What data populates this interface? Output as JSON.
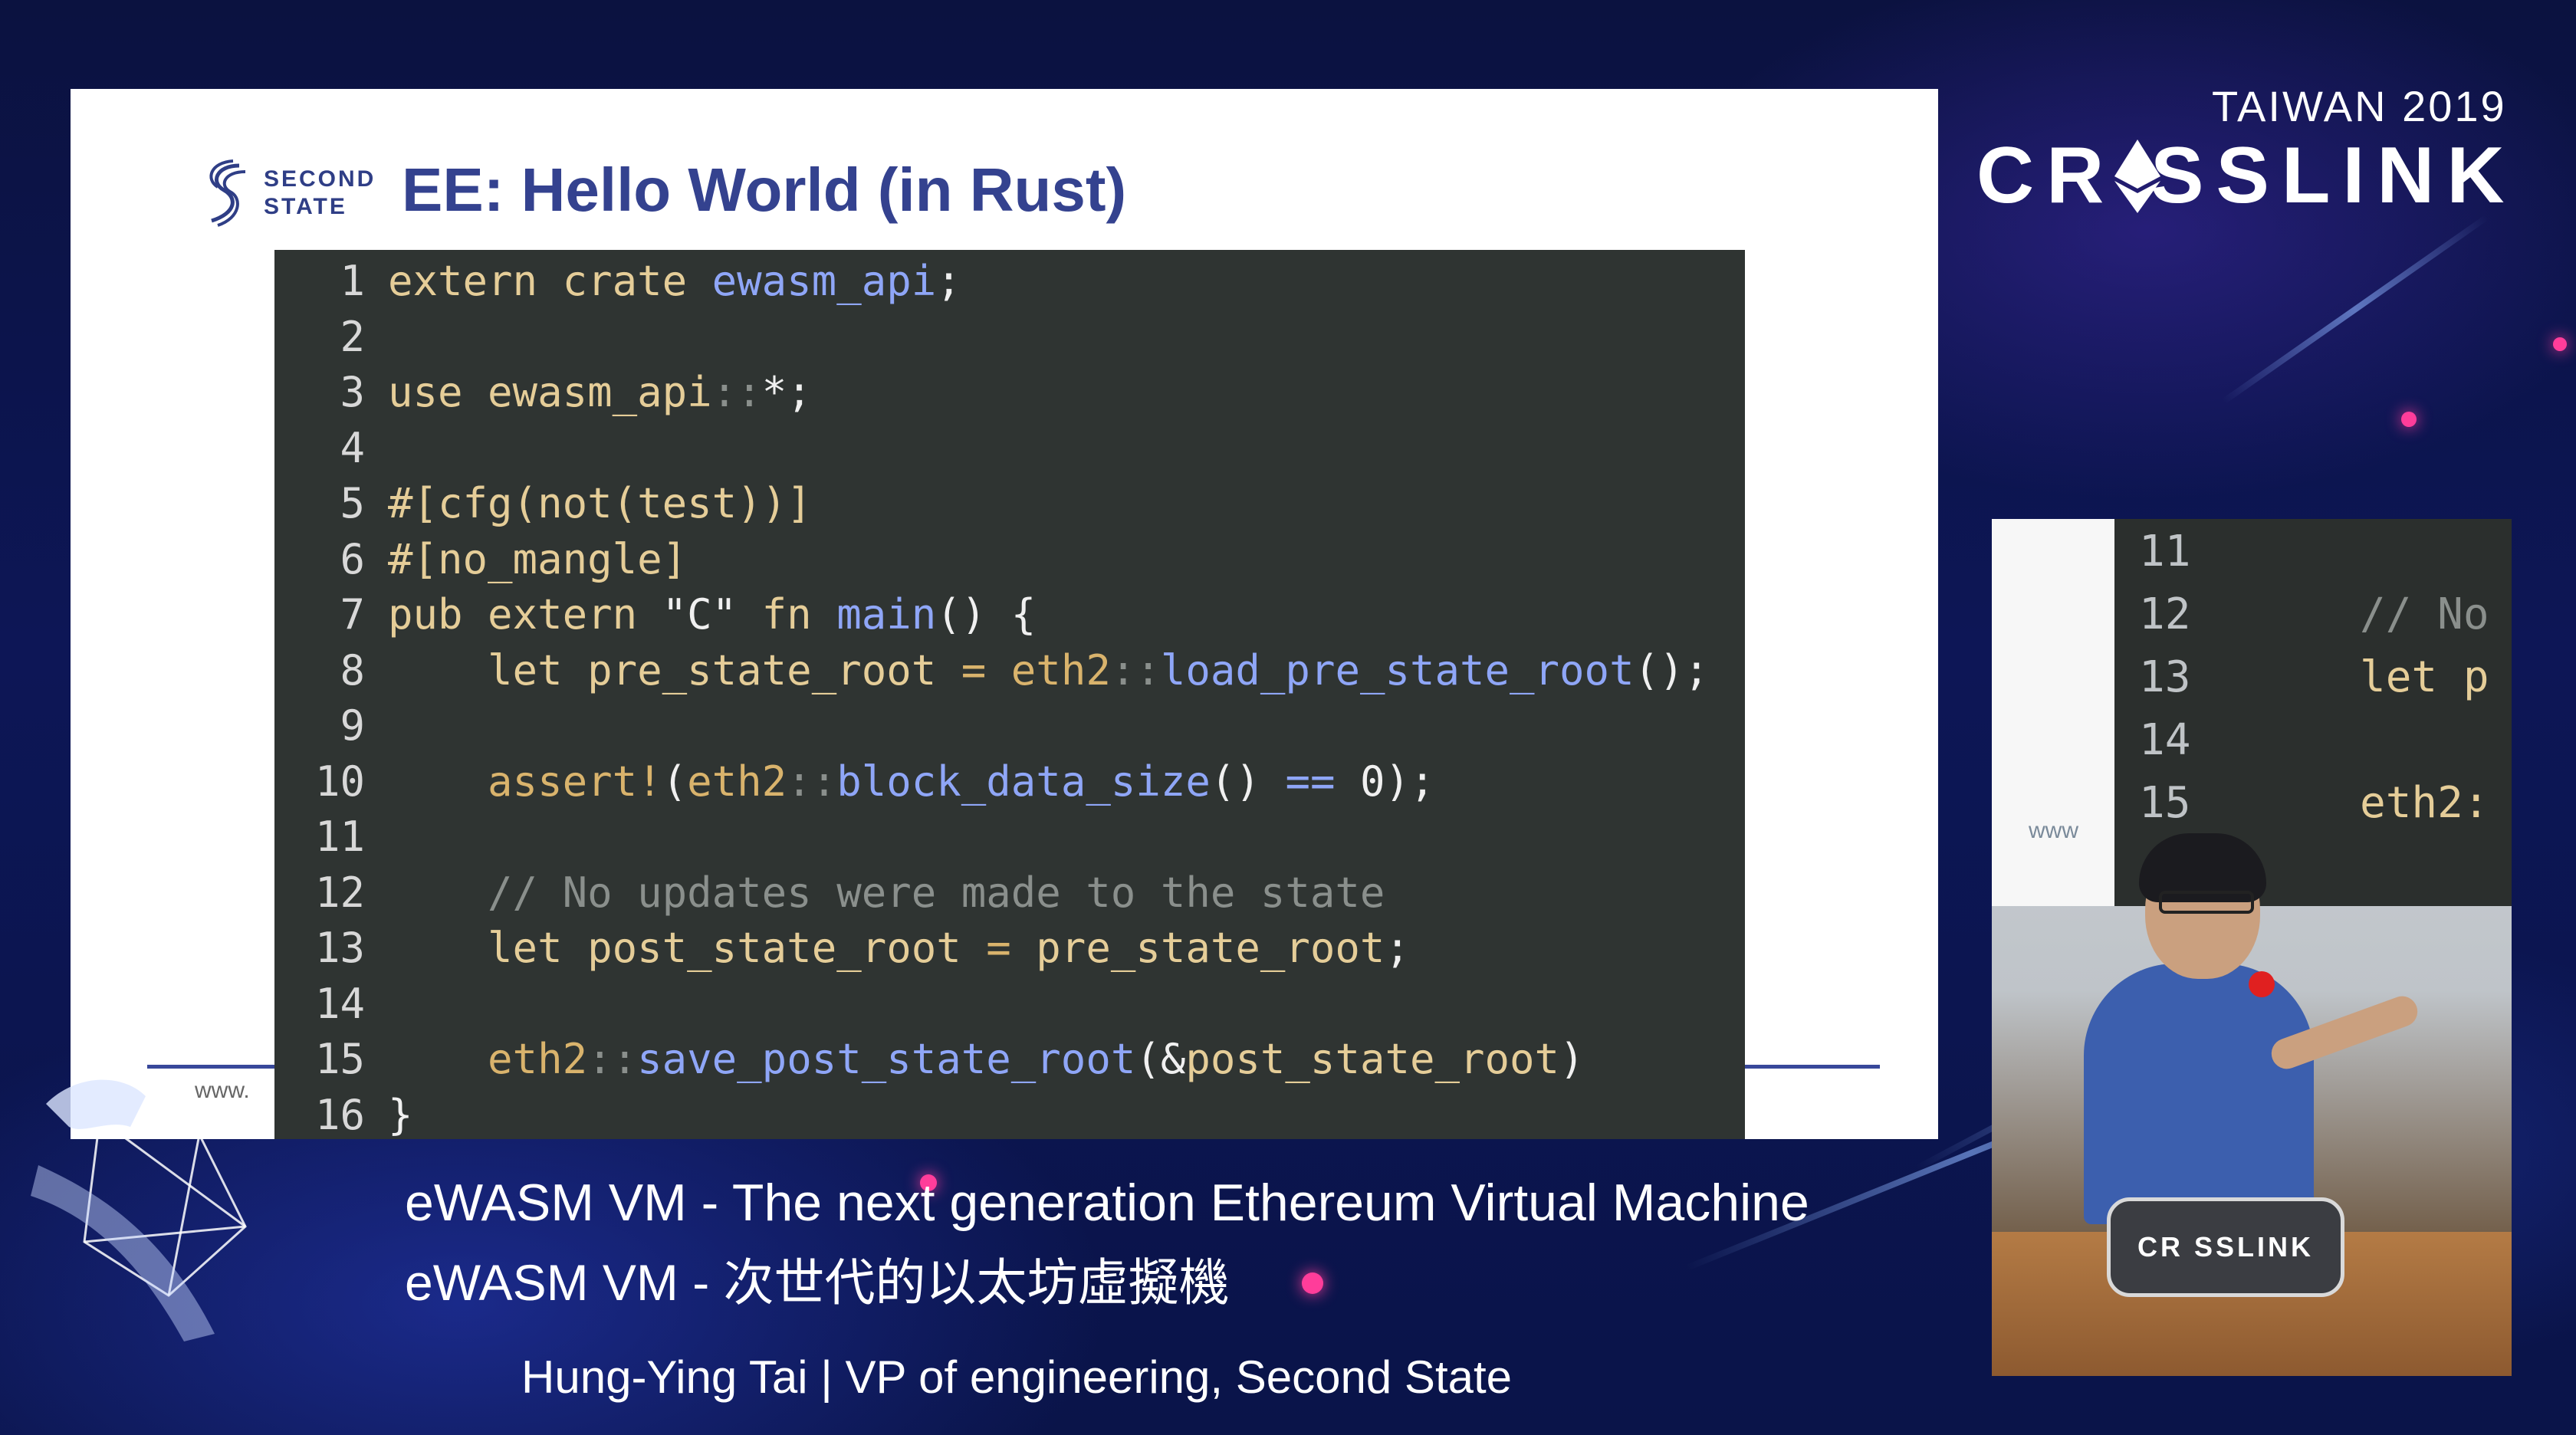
{
  "slide": {
    "logo_text_line1": "SECOND",
    "logo_text_line2": "STATE",
    "title": "EE: Hello World (in Rust)",
    "footer_url": "www."
  },
  "code": {
    "lines": [
      {
        "n": "1",
        "tokens": [
          [
            "k",
            "extern crate "
          ],
          [
            "f",
            "ewasm_api"
          ],
          [
            "p",
            ";"
          ]
        ]
      },
      {
        "n": "2",
        "tokens": []
      },
      {
        "n": "3",
        "tokens": [
          [
            "k",
            "use "
          ],
          [
            "k",
            "ewasm_api"
          ],
          [
            "c",
            "::"
          ],
          [
            "p",
            "*;"
          ]
        ]
      },
      {
        "n": "4",
        "tokens": []
      },
      {
        "n": "5",
        "tokens": [
          [
            "k",
            "#[cfg(not(test))]"
          ]
        ]
      },
      {
        "n": "6",
        "tokens": [
          [
            "k",
            "#[no_mangle]"
          ]
        ]
      },
      {
        "n": "7",
        "tokens": [
          [
            "k",
            "pub extern "
          ],
          [
            "p",
            "\"C\" "
          ],
          [
            "k",
            "fn "
          ],
          [
            "f",
            "main"
          ],
          [
            "p",
            "() {"
          ]
        ]
      },
      {
        "n": "8",
        "tokens": [
          [
            "k",
            "    let "
          ],
          [
            "k",
            "pre_state_root "
          ],
          [
            "o",
            "= "
          ],
          [
            "o",
            "eth2"
          ],
          [
            "c",
            "::"
          ],
          [
            "f",
            "load_pre_state_root"
          ],
          [
            "p",
            "();"
          ]
        ]
      },
      {
        "n": "9",
        "tokens": []
      },
      {
        "n": "10",
        "tokens": [
          [
            "o",
            "    assert!"
          ],
          [
            "p",
            "("
          ],
          [
            "o",
            "eth2"
          ],
          [
            "c",
            "::"
          ],
          [
            "f",
            "block_data_size"
          ],
          [
            "p",
            "() "
          ],
          [
            "f",
            "== "
          ],
          [
            "p",
            "0);"
          ]
        ]
      },
      {
        "n": "11",
        "tokens": []
      },
      {
        "n": "12",
        "tokens": [
          [
            "c",
            "    // No updates were made to the state"
          ]
        ]
      },
      {
        "n": "13",
        "tokens": [
          [
            "k",
            "    let "
          ],
          [
            "k",
            "post_state_root "
          ],
          [
            "o",
            "= "
          ],
          [
            "k",
            "pre_state_root"
          ],
          [
            "p",
            ";"
          ]
        ]
      },
      {
        "n": "14",
        "tokens": []
      },
      {
        "n": "15",
        "tokens": [
          [
            "o",
            "    eth2"
          ],
          [
            "c",
            "::"
          ],
          [
            "f",
            "save_post_state_root"
          ],
          [
            "p",
            "(&"
          ],
          [
            "k",
            "post_state_root"
          ],
          [
            "p",
            ")"
          ]
        ]
      },
      {
        "n": "16",
        "tokens": [
          [
            "p",
            "}"
          ]
        ]
      }
    ]
  },
  "brand": {
    "edition": "TAIWAN 2019",
    "name": "CR SSLINK",
    "accent": "#ffffff"
  },
  "lower_third": {
    "title_en": "eWASM VM - The next generation Ethereum Virtual Machine",
    "title_zh": "eWASM VM - 次世代的以太坊虛擬機",
    "speaker": "Hung-Ying Tai | VP of engineering, Second State"
  },
  "camera": {
    "screen_lines": [
      {
        "n": "11",
        "text": ""
      },
      {
        "n": "12",
        "text": "// No"
      },
      {
        "n": "13",
        "text": "let p"
      },
      {
        "n": "14",
        "text": ""
      },
      {
        "n": "15",
        "text": "eth2:"
      }
    ],
    "screen_url": "www",
    "podium_label": "CR SSLINK"
  }
}
